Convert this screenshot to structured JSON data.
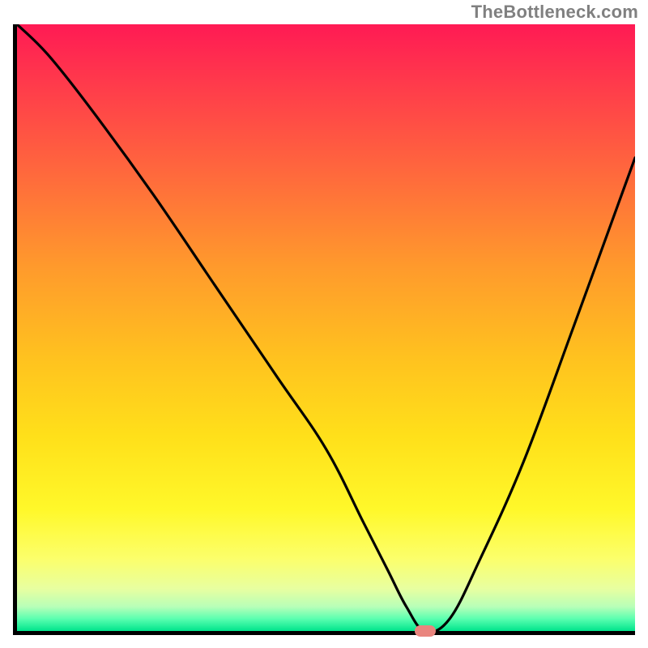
{
  "attribution": "TheBottleneck.com",
  "chart_data": {
    "type": "line",
    "title": "",
    "xlabel": "",
    "ylabel": "",
    "xlim": [
      0,
      100
    ],
    "ylim": [
      0,
      100
    ],
    "x": [
      0,
      5,
      12,
      22,
      32,
      42,
      50,
      56,
      60,
      63,
      66,
      70,
      75,
      82,
      90,
      100
    ],
    "values": [
      100,
      95,
      86,
      72,
      57,
      42,
      30,
      18,
      10,
      4,
      0,
      2,
      12,
      28,
      50,
      78
    ],
    "marker": {
      "x": 66,
      "y": 0
    },
    "background_gradient": {
      "top": "#ff1a54",
      "middle": "#ffe01a",
      "bottom": "#00e48c"
    }
  }
}
